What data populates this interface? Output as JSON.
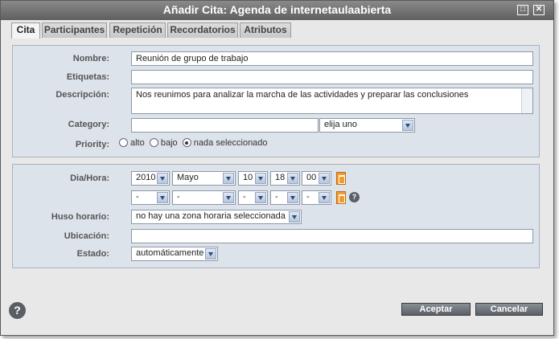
{
  "window": {
    "title": "Añadir Cita: Agenda de internetaulaabierta",
    "maximize_glyph": "□",
    "close_glyph": "✕"
  },
  "tabs": [
    {
      "label": "Cita",
      "active": true
    },
    {
      "label": "Participantes",
      "active": false
    },
    {
      "label": "Repetición",
      "active": false
    },
    {
      "label": "Recordatorios",
      "active": false
    },
    {
      "label": "Atributos",
      "active": false
    }
  ],
  "form1": {
    "nombre_label": "Nombre:",
    "nombre_value": "Reunión de grupo de trabajo",
    "etiquetas_label": "Etiquetas:",
    "etiquetas_value": "",
    "descripcion_label": "Descripción:",
    "descripcion_value": "Nos reunimos para analizar la marcha de las actividades y preparar las conclusiones",
    "category_label": "Category:",
    "category_value": "",
    "category_select": "elija uno",
    "priority_label": "Priority:",
    "priority_options": [
      {
        "label": "alto",
        "selected": false
      },
      {
        "label": "bajo",
        "selected": false
      },
      {
        "label": "nada seleccionado",
        "selected": true
      }
    ]
  },
  "form2": {
    "diahora_label": "Dia/Hora:",
    "start": {
      "year": "2010",
      "month": "Mayo",
      "day": "10",
      "hour": "18",
      "minute": "00"
    },
    "end": {
      "year": "-",
      "month": "-",
      "day": "-",
      "hour": "-",
      "minute": "-"
    },
    "huso_label": "Huso horario:",
    "huso_value": "no hay una zona horaria seleccionada",
    "ubicacion_label": "Ubicación:",
    "ubicacion_value": "",
    "estado_label": "Estado:",
    "estado_value": "automáticamente"
  },
  "footer": {
    "help_glyph": "?",
    "aceptar_label": "Aceptar",
    "cancelar_label": "Cancelar"
  },
  "colors": {
    "titlebar": "#6f6f6f",
    "panel_bg": "#dde3ea",
    "calendar_icon": "#f39a2b",
    "button": "#6c7179"
  }
}
